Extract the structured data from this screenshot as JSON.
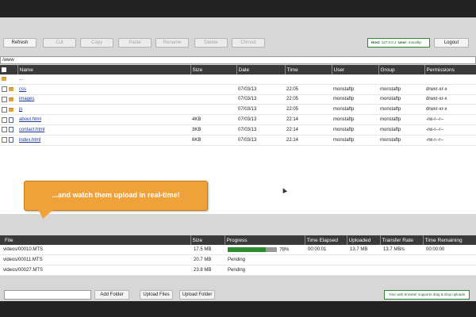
{
  "toolbar": {
    "buttons": [
      {
        "label": "Refresh"
      },
      {
        "label": "Cut"
      },
      {
        "label": "Copy"
      },
      {
        "label": "Paste"
      },
      {
        "label": "Rename"
      },
      {
        "label": "Delete"
      },
      {
        "label": "Chmod"
      }
    ],
    "host_label": "Host:",
    "host_value": "127.0.0.1",
    "user_label": "User:",
    "user_value": "monsftp",
    "logout_label": "Logout"
  },
  "path": "/www",
  "file_table": {
    "headers": [
      "",
      "Name",
      "Size",
      "Date",
      "Time",
      "User",
      "Group",
      "Permissions"
    ],
    "rows": [
      {
        "icon": "folder-icon",
        "name": "...",
        "size": "",
        "date": "",
        "time": "",
        "user": "",
        "group": "",
        "perms": ""
      },
      {
        "icon": "folder-icon",
        "name": "css",
        "size": "",
        "date": "07/03/13",
        "time": "22:05",
        "user": "monstaftp",
        "group": "monstaftp",
        "perms": "drwxr-xr-x"
      },
      {
        "icon": "folder-icon",
        "name": "images",
        "size": "",
        "date": "07/03/13",
        "time": "22:05",
        "user": "monstaftp",
        "group": "monstaftp",
        "perms": "drwxr-xr-x"
      },
      {
        "icon": "folder-icon",
        "name": "js",
        "size": "",
        "date": "07/03/13",
        "time": "22:05",
        "user": "monstaftp",
        "group": "monstaftp",
        "perms": "drwxr-xr-x"
      },
      {
        "icon": "document-icon",
        "name": "about.html",
        "size": "4KB",
        "date": "07/03/13",
        "time": "22:14",
        "user": "monstaftp",
        "group": "monstaftp",
        "perms": "-rw-r--r--"
      },
      {
        "icon": "document-icon",
        "name": "contact.html",
        "size": "3KB",
        "date": "07/03/13",
        "time": "22:14",
        "user": "monstaftp",
        "group": "monstaftp",
        "perms": "-rw-r--r--"
      },
      {
        "icon": "document-icon",
        "name": "index.html",
        "size": "6KB",
        "date": "07/03/13",
        "time": "22:14",
        "user": "monstaftp",
        "group": "monstaftp",
        "perms": "-rw-r--r--"
      }
    ]
  },
  "callout": "...and watch them upload in real-time!",
  "transfer_table": {
    "headers": [
      "File",
      "Size",
      "Progress",
      "Time Elapsed",
      "Uploaded",
      "Transfer Rate",
      "Time Remaining"
    ],
    "rows": [
      {
        "file": "videos/00010.MTS",
        "size": "17.5 MB",
        "progress_pct": 78,
        "progress_text": "78%",
        "elapsed": "00:00:01",
        "uploaded": "13.7 MB",
        "rate": "13.7 MB/s",
        "remaining": "00:00:00"
      },
      {
        "file": "videos/00011.MTS",
        "size": "20.7 MB",
        "progress_text": "Pending",
        "elapsed": "",
        "uploaded": "",
        "rate": "",
        "remaining": ""
      },
      {
        "file": "videos/00027.MTS",
        "size": "23.8 MB",
        "progress_text": "Pending",
        "elapsed": "",
        "uploaded": "",
        "rate": "",
        "remaining": ""
      }
    ]
  },
  "bottom": {
    "folder_input_value": "",
    "add_folder_label": "Add Folder",
    "upload_files_label": "Upload Files",
    "upload_folder_label": "Upload Folder",
    "drag_drop_note": "Your web browser supports drag & drop uploads"
  },
  "colors": {
    "accent": "#f0a23a",
    "progress": "#2e8b2e",
    "header_bg": "#3a3a3a"
  }
}
